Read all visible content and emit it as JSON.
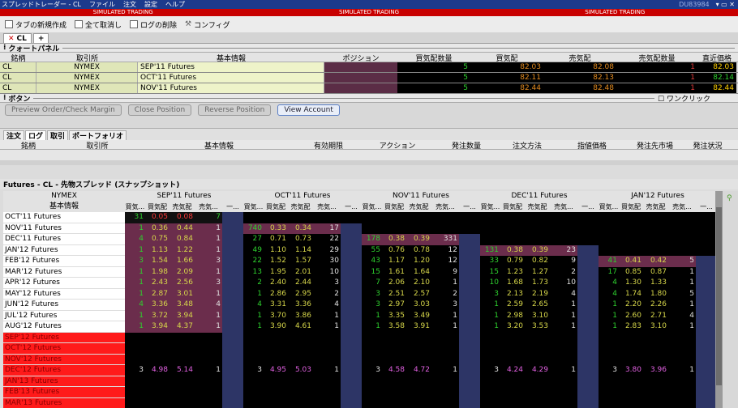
{
  "window": {
    "title": "スプレッドトレーダー - CL",
    "menu": [
      "ファイル",
      "注文",
      "設定",
      "ヘルプ"
    ],
    "account": "DU83984",
    "simulated": "SIMULATED TRADING"
  },
  "toolbar": {
    "new_tab": "タブの新規作成",
    "cancel_all": "全て取消し",
    "delete_log": "ログの削除",
    "config": "コンフィグ"
  },
  "tabs": {
    "main": "CL",
    "add": "+"
  },
  "quote_panel": {
    "title": "クォートパネル",
    "columns": [
      "銘柄",
      "取引所",
      "基本情報",
      "ポジション",
      "買気配数量",
      "買気配",
      "売気配",
      "売気配数量",
      "直近価格"
    ],
    "rows": [
      {
        "symbol": "CL",
        "exchange": "NYMEX",
        "desc": "SEP'11 Futures",
        "position": "",
        "bid_size": "5",
        "bid": "82.03",
        "ask": "82.08",
        "ask_size": "1",
        "last": "82.03"
      },
      {
        "symbol": "CL",
        "exchange": "NYMEX",
        "desc": "OCT'11 Futures",
        "position": "",
        "bid_size": "5",
        "bid": "82.11",
        "ask": "82.13",
        "ask_size": "1",
        "last": "82.14"
      },
      {
        "symbol": "CL",
        "exchange": "NYMEX",
        "desc": "NOV'11 Futures",
        "position": "",
        "bid_size": "5",
        "bid": "82.44",
        "ask": "82.48",
        "ask_size": "1",
        "last": "82.44"
      }
    ]
  },
  "button_panel": {
    "title": "ボタン",
    "one_click": "ワンクリック",
    "buttons": [
      "Preview Order/Check Margin",
      "Close Position",
      "Reverse Position",
      "View Account"
    ]
  },
  "order_panel": {
    "tabs": [
      "注文",
      "ログ",
      "取引",
      "ポートフォリオ"
    ],
    "columns": [
      "銘柄",
      "取引所",
      "基本情報",
      "有効期限",
      "アクション",
      "発注数量",
      "注文方法",
      "指値価格",
      "発注先市場",
      "発注状況"
    ]
  },
  "spread": {
    "title": "Futures - CL - 先物スプレッド (スナップショット)",
    "exchange": "NYMEX",
    "desc_header": "基本情報",
    "months": [
      "SEP'11 Futures",
      "OCT'11 Futures",
      "NOV'11 Futures",
      "DEC'11 Futures",
      "JAN'12 Futures"
    ],
    "subcols": [
      "買気...",
      "買気配",
      "売気配",
      "売気...",
      "一..."
    ],
    "row_labels": [
      "OCT'11 Futures",
      "NOV'11 Futures",
      "DEC'11 Futures",
      "JAN'12 Futures",
      "FEB'12 Futures",
      "MAR'12 Futures",
      "APR'12 Futures",
      "MAY'12 Futures",
      "JUN'12 Futures",
      "JUL'12 Futures",
      "AUG'12 Futures",
      "SEP'12 Futures",
      "OCT'12 Futures",
      "NOV'12 Futures",
      "DEC'12 Futures",
      "JAN'13 Futures",
      "FEB'13 Futures",
      "MAR'13 Futures"
    ],
    "cells": [
      [
        [
          "31",
          "0.05",
          "0.08",
          "7"
        ],
        null,
        null,
        null,
        null
      ],
      [
        [
          "1",
          "0.36",
          "0.44",
          "1"
        ],
        [
          "740",
          "0.33",
          "0.34",
          "17"
        ],
        null,
        null,
        null
      ],
      [
        [
          "4",
          "0.75",
          "0.84",
          "1"
        ],
        [
          "27",
          "0.71",
          "0.73",
          "22"
        ],
        [
          "178",
          "0.38",
          "0.39",
          "331"
        ],
        null,
        null
      ],
      [
        [
          "1",
          "1.13",
          "1.22",
          "1"
        ],
        [
          "49",
          "1.10",
          "1.14",
          "29"
        ],
        [
          "55",
          "0.76",
          "0.78",
          "12"
        ],
        [
          "131",
          "0.38",
          "0.39",
          "23"
        ],
        null
      ],
      [
        [
          "3",
          "1.54",
          "1.66",
          "3"
        ],
        [
          "22",
          "1.52",
          "1.57",
          "30"
        ],
        [
          "43",
          "1.17",
          "1.20",
          "12"
        ],
        [
          "33",
          "0.79",
          "0.82",
          "9"
        ],
        [
          "41",
          "0.41",
          "0.42",
          "5"
        ]
      ],
      [
        [
          "1",
          "1.98",
          "2.09",
          "1"
        ],
        [
          "13",
          "1.95",
          "2.01",
          "10"
        ],
        [
          "15",
          "1.61",
          "1.64",
          "9"
        ],
        [
          "15",
          "1.23",
          "1.27",
          "2"
        ],
        [
          "17",
          "0.85",
          "0.87",
          "1"
        ]
      ],
      [
        [
          "1",
          "2.43",
          "2.56",
          "3"
        ],
        [
          "2",
          "2.40",
          "2.44",
          "3"
        ],
        [
          "7",
          "2.06",
          "2.10",
          "1"
        ],
        [
          "10",
          "1.68",
          "1.73",
          "10"
        ],
        [
          "4",
          "1.30",
          "1.33",
          "1"
        ]
      ],
      [
        [
          "1",
          "2.87",
          "3.01",
          "1"
        ],
        [
          "1",
          "2.86",
          "2.95",
          "2"
        ],
        [
          "3",
          "2.51",
          "2.57",
          "2"
        ],
        [
          "3",
          "2.13",
          "2.19",
          "4"
        ],
        [
          "4",
          "1.74",
          "1.80",
          "5"
        ]
      ],
      [
        [
          "4",
          "3.36",
          "3.48",
          "4"
        ],
        [
          "4",
          "3.31",
          "3.36",
          "4"
        ],
        [
          "3",
          "2.97",
          "3.03",
          "3"
        ],
        [
          "1",
          "2.59",
          "2.65",
          "1"
        ],
        [
          "1",
          "2.20",
          "2.26",
          "1"
        ]
      ],
      [
        [
          "1",
          "3.72",
          "3.94",
          "1"
        ],
        [
          "1",
          "3.70",
          "3.86",
          "1"
        ],
        [
          "1",
          "3.35",
          "3.49",
          "1"
        ],
        [
          "1",
          "2.98",
          "3.10",
          "1"
        ],
        [
          "1",
          "2.60",
          "2.71",
          "4"
        ]
      ],
      [
        [
          "1",
          "3.94",
          "4.37",
          "1"
        ],
        [
          "1",
          "3.90",
          "4.61",
          "1"
        ],
        [
          "1",
          "3.58",
          "3.91",
          "1"
        ],
        [
          "1",
          "3.20",
          "3.53",
          "1"
        ],
        [
          "1",
          "2.83",
          "3.10",
          "1"
        ]
      ],
      [
        null,
        null,
        null,
        null,
        null
      ],
      [
        null,
        null,
        null,
        null,
        null
      ],
      [
        null,
        null,
        null,
        null,
        null
      ],
      [
        [
          "3",
          "4.98",
          "5.14",
          "1"
        ],
        [
          "3",
          "4.95",
          "5.03",
          "1"
        ],
        [
          "3",
          "4.58",
          "4.72",
          "1"
        ],
        [
          "3",
          "4.24",
          "4.29",
          "1"
        ],
        [
          "3",
          "3.80",
          "3.96",
          "1"
        ]
      ],
      [
        null,
        null,
        null,
        null,
        null
      ],
      [
        null,
        null,
        null,
        null,
        null
      ],
      [
        null,
        null,
        null,
        null,
        null
      ]
    ]
  },
  "colors": {
    "accent_blue": "#1c3a8c",
    "sim_red": "#c80000",
    "bid_green": "#2ed12e",
    "price_orange": "#e38b1f",
    "ask_red": "#e13a3a",
    "cell_magenta": "#c9508a"
  }
}
